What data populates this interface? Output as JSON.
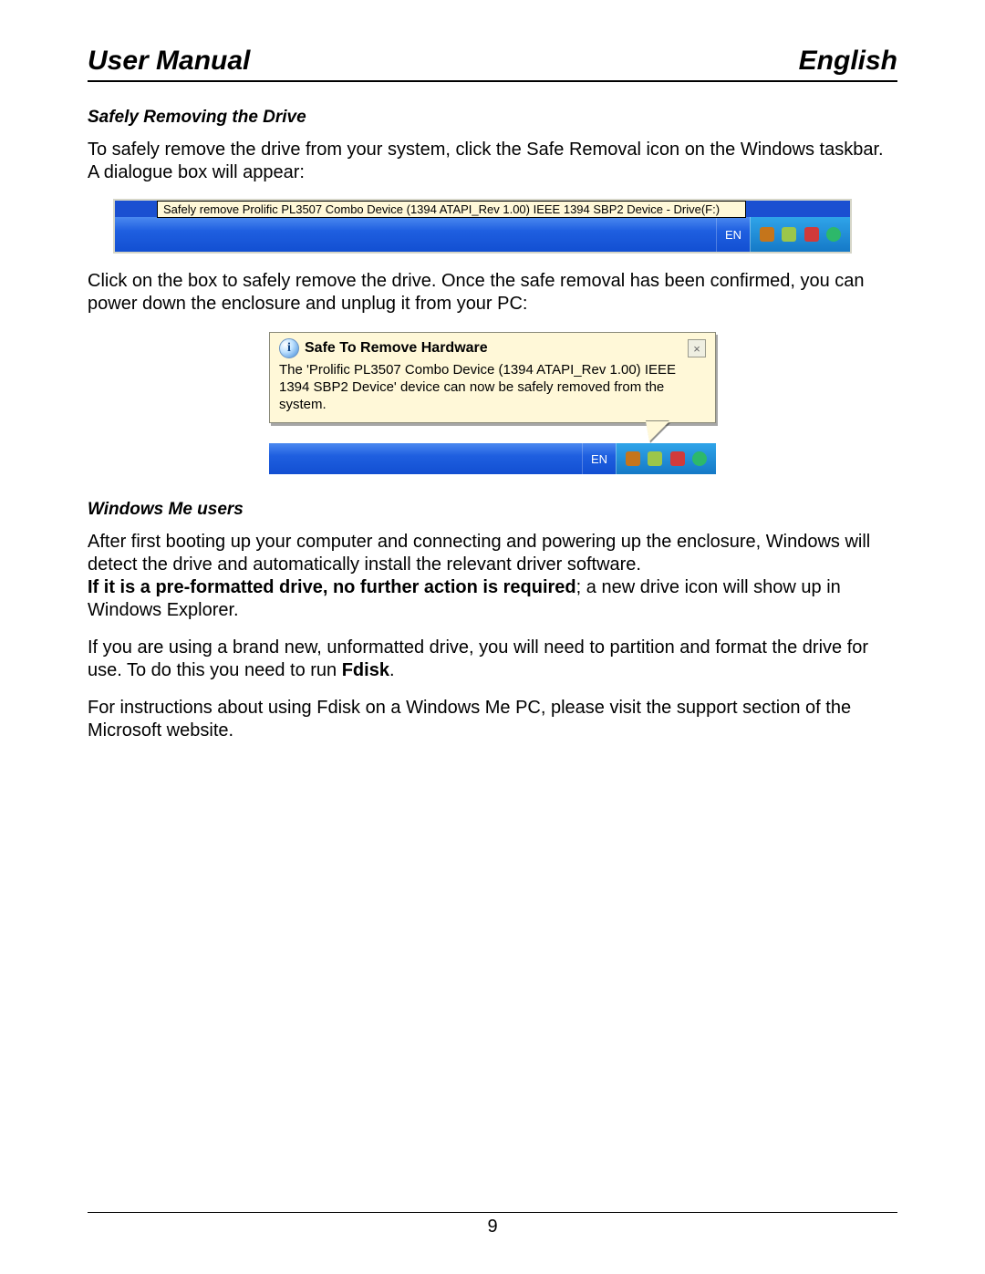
{
  "header": {
    "left": "User Manual",
    "right": "English"
  },
  "section1": {
    "title": "Safely Removing the Drive",
    "para1": "To safely remove the drive from your system, click the Safe Removal icon on the Windows taskbar. A dialogue box will appear:",
    "para2": "Click on the box to safely remove the drive. Once the safe removal has been confirmed, you can power down the enclosure and unplug it from your PC:"
  },
  "fig1": {
    "tooltip": "Safely remove Prolific PL3507 Combo Device (1394 ATAPI_Rev 1.00) IEEE 1394 SBP2 Device - Drive(F:)",
    "lang": "EN"
  },
  "fig2": {
    "info_glyph": "i",
    "close_glyph": "×",
    "title": "Safe To Remove Hardware",
    "body": "The 'Prolific PL3507 Combo Device (1394 ATAPI_Rev 1.00) IEEE 1394 SBP2 Device' device can now be safely removed from the system.",
    "lang": "EN"
  },
  "section2": {
    "title": "Windows Me users",
    "para1": "After first booting up your computer and connecting and powering up the enclosure, Windows will detect the drive and automatically install the relevant driver software.",
    "para2_bold": "If it is a pre-formatted drive, no further action is required",
    "para2_rest": "; a new drive icon will show up in Windows Explorer.",
    "para3_a": "If you are using a brand new, unformatted drive, you will need to partition and format the drive for use. To do this you need to run ",
    "para3_bold": "Fdisk",
    "para3_b": ".",
    "para4": "For instructions about using Fdisk on a Windows Me PC, please visit the support section of the Microsoft website."
  },
  "footer": {
    "page_number": "9"
  }
}
